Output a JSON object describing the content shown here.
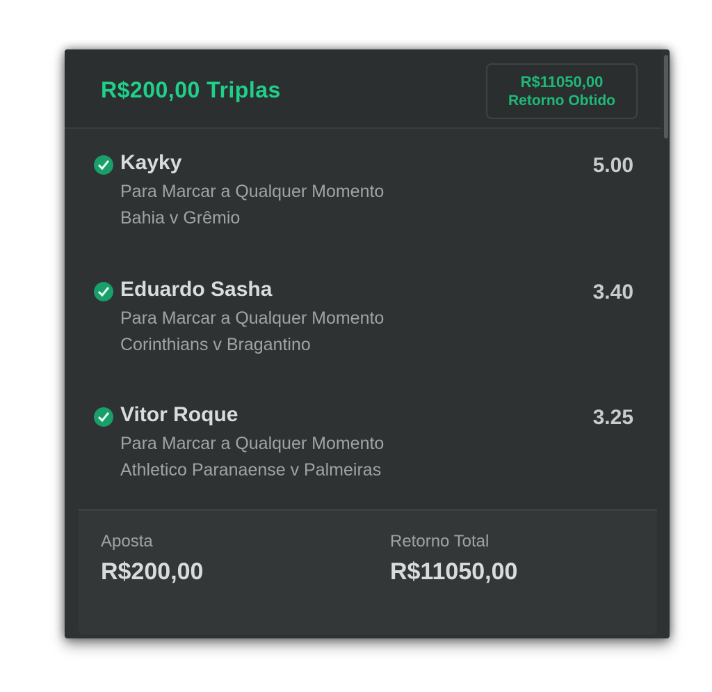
{
  "header": {
    "title": "R$200,00 Triplas",
    "return_amount": "R$11050,00",
    "return_label": "Retorno Obtido"
  },
  "selections": [
    {
      "player": "Kayky",
      "odds": "5.00",
      "market": "Para Marcar a Qualquer Momento",
      "match": "Bahia v Grêmio",
      "status_icon": "check-icon"
    },
    {
      "player": "Eduardo Sasha",
      "odds": "3.40",
      "market": "Para Marcar a Qualquer Momento",
      "match": "Corinthians v Bragantino",
      "status_icon": "check-icon"
    },
    {
      "player": "Vitor Roque",
      "odds": "3.25",
      "market": "Para Marcar a Qualquer Momento",
      "match": "Athletico Paranaense v Palmeiras",
      "status_icon": "check-icon"
    }
  ],
  "footer": {
    "stake_label": "Aposta",
    "stake_value": "R$200,00",
    "total_label": "Retorno Total",
    "total_value": "R$11050,00"
  },
  "colors": {
    "accent": "#1fd08a",
    "background": "#2e3232",
    "check": "#1a9e6a"
  }
}
